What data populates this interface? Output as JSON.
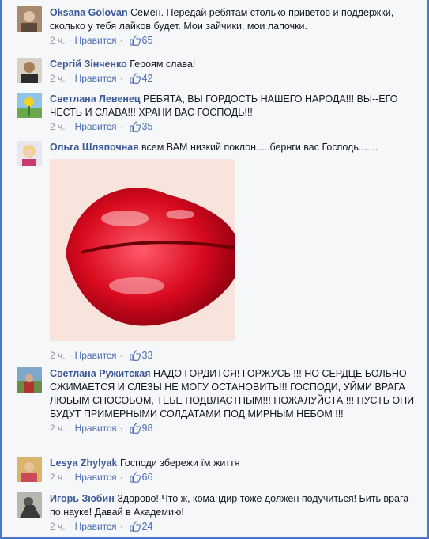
{
  "comments": [
    {
      "author": "Oksana Golovan",
      "text": "Семен. Передай ребятам столько приветов и поддержки, сколько у тебя лайков будет. Мои зайчики, мои лапочки.",
      "time": "2 ч.",
      "like": "Нравится",
      "likes": "65"
    },
    {
      "author": "Сергій Зінченко",
      "text": "Героям слава!",
      "time": "2 ч.",
      "like": "Нравится",
      "likes": "42"
    },
    {
      "author": "Светлана Левенец",
      "text": "РЕБЯТА, ВЫ ГОРДОСТЬ НАШЕГО НАРОДА!!! ВЫ--ЕГО ЧЕСТЬ И СЛАВА!!! ХРАНИ ВАС ГОСПОДЬ!!!",
      "time": "2 ч.",
      "like": "Нравится",
      "likes": "35"
    },
    {
      "author": "Ольга Шляпочная",
      "text": "всем ВАМ низкий поклон.....бернги вас Господь.......",
      "time": "2 ч.",
      "like": "Нравится",
      "likes": "33"
    },
    {
      "author": "Светлана Ружитская",
      "text": "НАДО ГОРДИТСЯ! ГОРЖУСЬ !!! НО СЕРДЦЕ БОЛЬНО СЖИМАЕТСЯ И СЛЕЗЫ НЕ МОГУ ОСТАНОВИТЬ!!! ГОСПОДИ, УЙМИ ВРАГА ЛЮБЫМ СПОСОБОМ, ТЕБЕ ПОДВЛАСТНЫМ!!! ПОЖАЛУЙСТА !!! ПУСТЬ ОНИ БУДУТ ПРИМЕРНЫМИ СОЛДАТАМИ ПОД МИРНЫМ НЕБОМ !!!",
      "time": "2 ч.",
      "like": "Нравится",
      "likes": "98"
    },
    {
      "author": "Lesya Zhylyak",
      "text": "Господи збережи їм життя",
      "time": "2 ч.",
      "like": "Нравится",
      "likes": "66"
    },
    {
      "author": "Игорь Зюбин",
      "text": "Здорово! Что ж, командир тоже должен подучиться! Бить врага по науке! Давай в Академию!",
      "time": "2 ч.",
      "like": "Нравится",
      "likes": "24"
    }
  ],
  "colors": {
    "link": "#3b5998",
    "frame": "#4a76c5",
    "meta": "#90949c"
  }
}
